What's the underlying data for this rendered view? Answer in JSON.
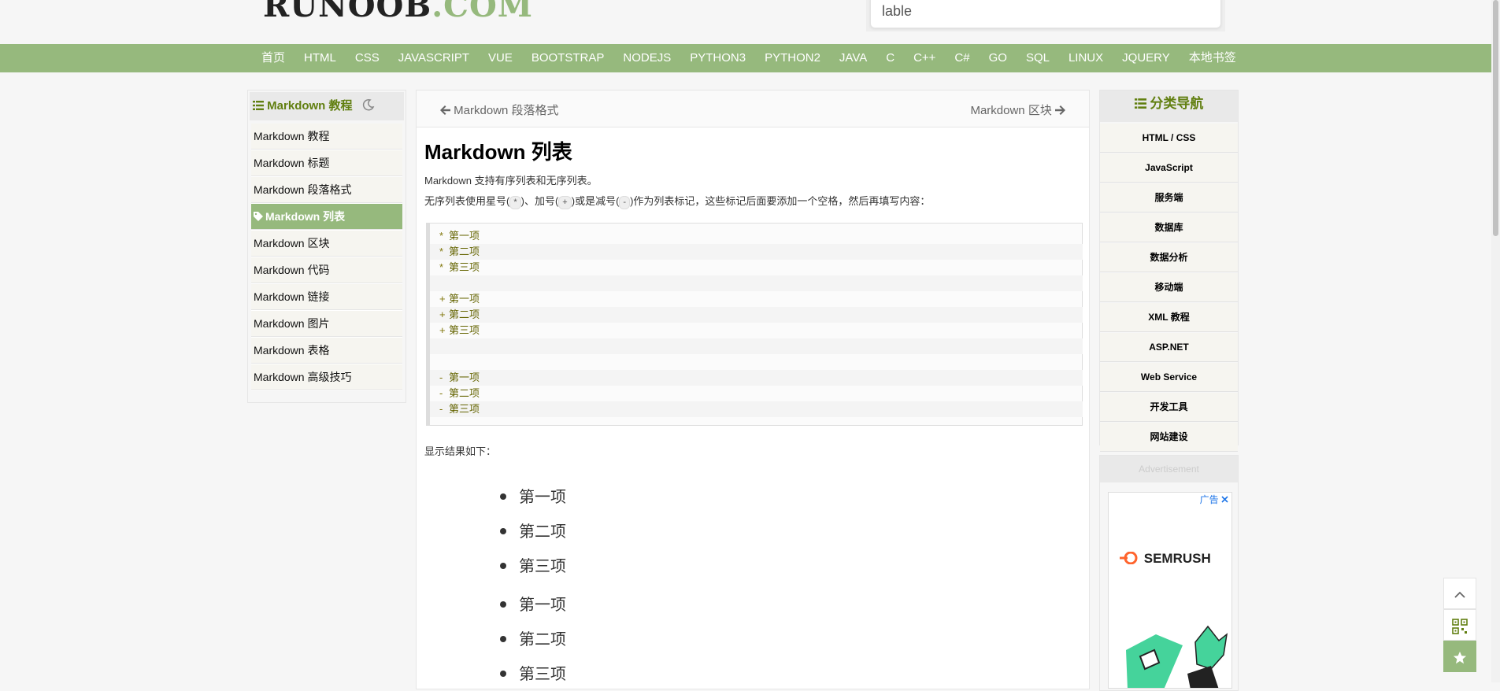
{
  "header": {
    "logo_part1": "RUNOOB",
    "logo_part2": ".COM",
    "search_value": "lable"
  },
  "topnav": {
    "items": [
      "首页",
      "HTML",
      "CSS",
      "JAVASCRIPT",
      "VUE",
      "BOOTSTRAP",
      "NODEJS",
      "PYTHON3",
      "PYTHON2",
      "JAVA",
      "C",
      "C++",
      "C#",
      "GO",
      "SQL",
      "LINUX",
      "JQUERY",
      "本地书签"
    ]
  },
  "left_sidebar": {
    "title": "Markdown 教程",
    "items": [
      "Markdown 教程",
      "Markdown 标题",
      "Markdown 段落格式",
      "Markdown 列表",
      "Markdown 区块",
      "Markdown 代码",
      "Markdown 链接",
      "Markdown 图片",
      "Markdown 表格",
      "Markdown 高级技巧"
    ],
    "active_index": 3
  },
  "main": {
    "prev_label": "Markdown 段落格式",
    "next_label": "Markdown 区块",
    "title": "Markdown 列表",
    "intro": "Markdown 支持有序列表和无序列表。",
    "desc_before": "无序列表使用星号(",
    "key_star": "*",
    "desc_mid1": ")、加号(",
    "key_plus": "+",
    "desc_mid2": ")或是减号(",
    "key_minus": "-",
    "desc_after": ")作为列表标记，这些标记后面要添加一个空格，然后再填写内容：",
    "code_lines": [
      {
        "marker": "*",
        "text": "第一项"
      },
      {
        "marker": "*",
        "text": "第二项"
      },
      {
        "marker": "*",
        "text": "第三项"
      },
      {
        "marker": "",
        "text": ""
      },
      {
        "marker": "+",
        "text": "第一项"
      },
      {
        "marker": "+",
        "text": "第二项"
      },
      {
        "marker": "+",
        "text": "第三项"
      },
      {
        "marker": "",
        "text": ""
      },
      {
        "marker": "",
        "text": ""
      },
      {
        "marker": "-",
        "text": "第一项"
      },
      {
        "marker": "-",
        "text": "第二项"
      },
      {
        "marker": "-",
        "text": "第三项"
      }
    ],
    "result_label": "显示结果如下：",
    "rendered_items": [
      "第一项",
      "第二项",
      "第三项",
      "第一项",
      "第二项",
      "第三项"
    ]
  },
  "right_sidebar": {
    "title": "分类导航",
    "items": [
      "HTML / CSS",
      "JavaScript",
      "服务端",
      "数据库",
      "数据分析",
      "移动端",
      "XML 教程",
      "ASP.NET",
      "Web Service",
      "开发工具",
      "网站建设"
    ]
  },
  "ad": {
    "header": "Advertisement",
    "corner": "广告",
    "brand": "SEMRUSH"
  },
  "colors": {
    "accent": "#96b97d",
    "heading_green": "#617f10"
  },
  "icons": {
    "list": "list-icon",
    "moon": "moon-icon",
    "tag": "tag-icon",
    "arrow_left": "arrow-left-icon",
    "arrow_right": "arrow-right-icon",
    "up": "chevron-up-icon",
    "qr": "qrcode-icon",
    "star": "star-icon"
  }
}
